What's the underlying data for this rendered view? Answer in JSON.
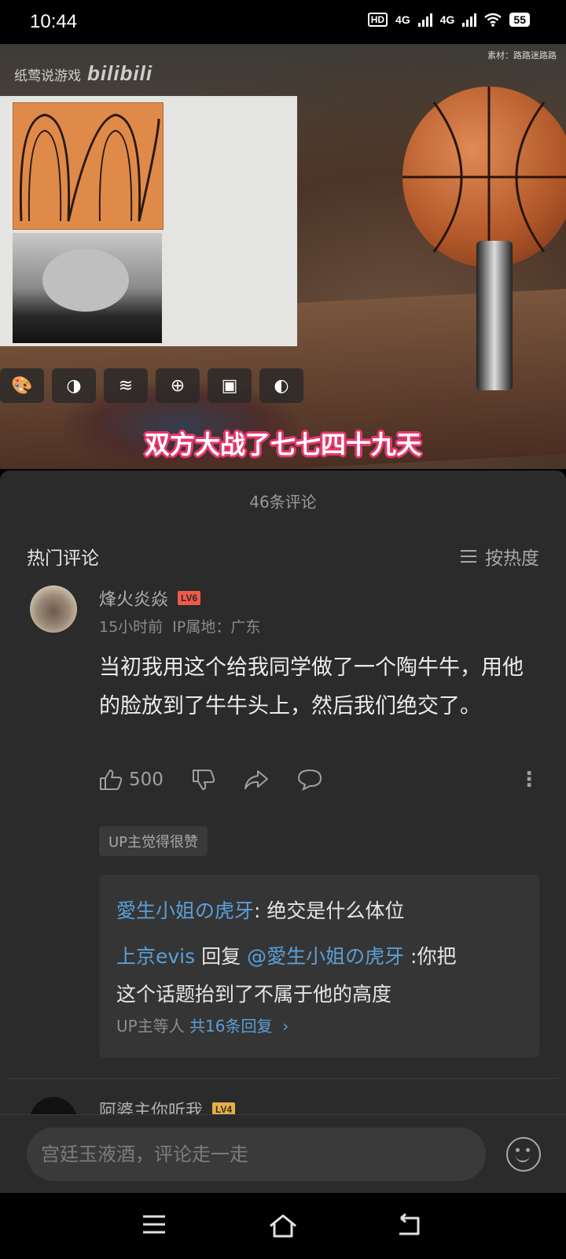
{
  "status_bar": {
    "time": "10:44",
    "hd_label": "HD",
    "net1": "4G",
    "net2": "4G",
    "battery": "55"
  },
  "video": {
    "watermark_text": "纸莺说游戏",
    "watermark_logo": "bilibili",
    "source_credit": "素材：路路迷路路",
    "subtitle": "双方大战了七七四十九天",
    "toolbar_icons": [
      "palette-icon",
      "circle-icon",
      "pattern-icon",
      "globe-icon",
      "image-icon",
      "contrast-icon"
    ]
  },
  "comments": {
    "count_label": "46条评论",
    "section_title": "热门评论",
    "sort_label": "按热度",
    "top_comment": {
      "username": "烽火炎焱",
      "level": "LV6",
      "time": "15小时前",
      "ip": "IP属地：广东",
      "text": "当初我用这个给我同学做了一个陶牛牛，用他的脸放到了牛牛头上，然后我们绝交了。",
      "likes": "500",
      "up_badge": "UP主觉得很赞",
      "replies": [
        {
          "user": "愛生小姐の虎牙",
          "text": ": 绝交是什么体位"
        },
        {
          "user": "上京evis",
          "reply_word": " 回复 ",
          "mention": "@愛生小姐の虎牙",
          "text": " :你把",
          "text2": "这个话题抬到了不属于他的高度"
        }
      ],
      "more_prefix": "UP主等人",
      "more_link": "共16条回复"
    },
    "next_comment": {
      "username": "阿婆主你听我",
      "level": "LV4"
    }
  },
  "input": {
    "placeholder": "宫廷玉液酒，评论走一走"
  },
  "colors": {
    "link": "#5a9fd8",
    "level6": "#f05a4a",
    "subtitle_outline": "#e5376d"
  }
}
